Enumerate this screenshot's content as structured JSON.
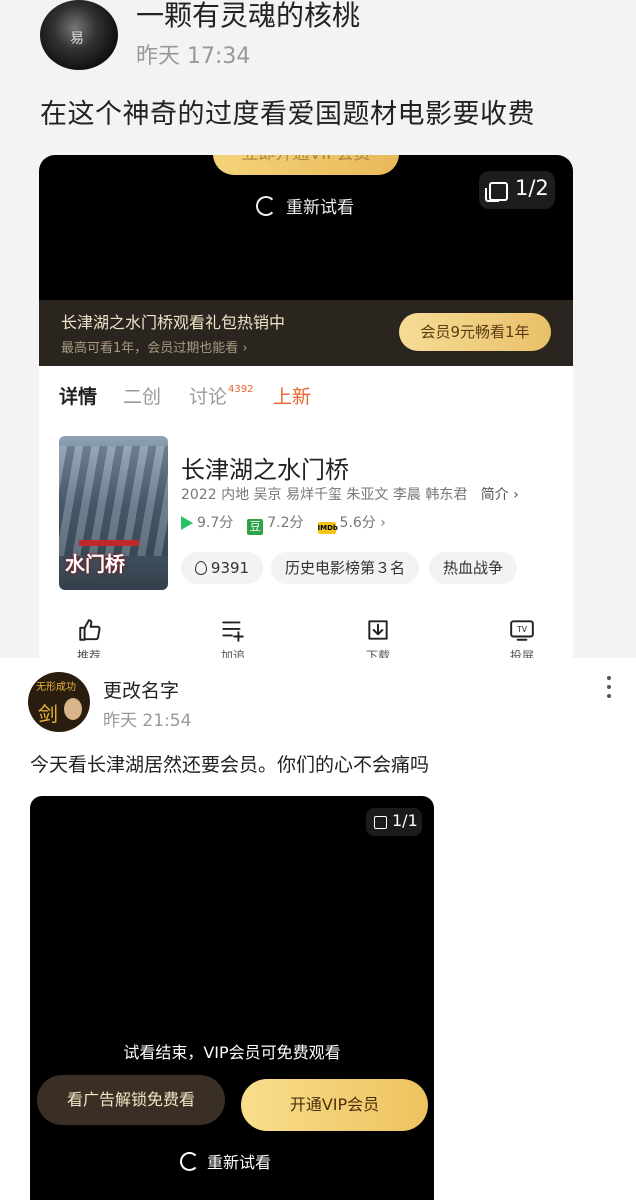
{
  "post1": {
    "author": "一颗有灵魂的核桃",
    "avatar_glyph": "易",
    "time": "昨天 17:34",
    "content": "在这个神奇的过度看爱国题材电影要收费",
    "player": {
      "image_counter": "1/2",
      "replay_label": "重新试看",
      "top_button_partial": "立即开通VIP会员"
    },
    "promo": {
      "title": "长津湖之水门桥观看礼包热销中",
      "subtitle": "最高可看1年，会员过期也能看 ›",
      "button": "会员9元畅看1年"
    },
    "tabs": [
      {
        "label": "详情"
      },
      {
        "label": "二创"
      },
      {
        "label": "讨论",
        "badge": "4392"
      },
      {
        "label": "上新"
      }
    ],
    "movie": {
      "poster_text": "水门桥",
      "title": "长津湖之水门桥",
      "info": "2022 内地 吴京 易烊千玺 朱亚文 李晨 韩东君",
      "intro_link": "简介 ›",
      "ratings": [
        {
          "icon": "play-triangle-icon",
          "value": "9.7分"
        },
        {
          "icon": "douban-icon",
          "glyph": "豆",
          "value": "7.2分"
        },
        {
          "icon": "imdb-icon",
          "glyph": "IMDb",
          "value": "5.6分 ›"
        }
      ],
      "chips": [
        "9391",
        "历史电影榜第３名",
        "热血战争"
      ]
    },
    "actions": [
      {
        "icon": "thumb-up-icon",
        "label": "推荐"
      },
      {
        "icon": "add-list-icon",
        "label": "加追"
      },
      {
        "icon": "download-icon",
        "label": "下载"
      },
      {
        "icon": "tv-cast-icon",
        "label": "投屏"
      }
    ]
  },
  "post2": {
    "author": "更改名字",
    "avatar_text_top": "无形成功",
    "avatar_text_big": "剑",
    "time": "昨天 21:54",
    "content": "今天看长津湖居然还要会员。你们的心不会痛吗",
    "video": {
      "image_counter": "1/1",
      "end_text": "试看结束，VIP会员可免费观看",
      "ad_button": "看广告解锁免费看",
      "vip_button": "开通VIP会员",
      "replay_label": "重新试看"
    }
  },
  "colors": {
    "gold": "#eec25f",
    "accent_orange": "#e8652f",
    "promo_bg": "#2b2520",
    "player_bg": "#000000"
  }
}
